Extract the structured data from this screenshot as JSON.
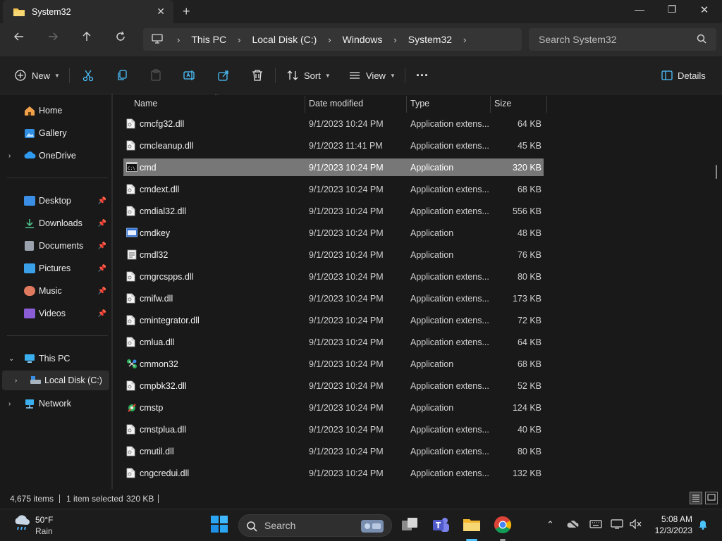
{
  "window": {
    "tab_title": "System32",
    "tab_close": "✕",
    "new_tab": "+",
    "minimize": "—",
    "maximize": "❐",
    "close": "✕"
  },
  "address": {
    "breadcrumbs": [
      "This PC",
      "Local Disk (C:)",
      "Windows",
      "System32"
    ],
    "search_placeholder": "Search System32"
  },
  "commandbar": {
    "new_label": "New",
    "sort_label": "Sort",
    "view_label": "View",
    "more_label": "···",
    "details_label": "Details"
  },
  "sidebar": {
    "home": "Home",
    "gallery": "Gallery",
    "onedrive": "OneDrive",
    "quick": [
      {
        "label": "Desktop",
        "icon": "desktop-icon",
        "color": "#3a8ee6"
      },
      {
        "label": "Downloads",
        "icon": "download-icon",
        "color": "#4cc38a"
      },
      {
        "label": "Documents",
        "icon": "document-icon",
        "color": "#9aa3ad"
      },
      {
        "label": "Pictures",
        "icon": "pictures-icon",
        "color": "#3aa0e8"
      },
      {
        "label": "Music",
        "icon": "music-icon",
        "color": "#e07a5f"
      },
      {
        "label": "Videos",
        "icon": "video-icon",
        "color": "#8a5cd6"
      }
    ],
    "this_pc": "This PC",
    "local_disk": "Local Disk (C:)",
    "network": "Network"
  },
  "list": {
    "columns": [
      "Name",
      "Date modified",
      "Type",
      "Size"
    ],
    "rows": [
      {
        "name": "cmcfg32.dll",
        "date": "9/1/2023 10:24 PM",
        "type": "Application extens...",
        "size": "64 KB",
        "icon": "dll"
      },
      {
        "name": "cmcleanup.dll",
        "date": "9/1/2023 11:41 PM",
        "type": "Application extens...",
        "size": "45 KB",
        "icon": "dll"
      },
      {
        "name": "cmd",
        "date": "9/1/2023 10:24 PM",
        "type": "Application",
        "size": "320 KB",
        "icon": "cmd",
        "selected": true
      },
      {
        "name": "cmdext.dll",
        "date": "9/1/2023 10:24 PM",
        "type": "Application extens...",
        "size": "68 KB",
        "icon": "dll"
      },
      {
        "name": "cmdial32.dll",
        "date": "9/1/2023 10:24 PM",
        "type": "Application extens...",
        "size": "556 KB",
        "icon": "dll"
      },
      {
        "name": "cmdkey",
        "date": "9/1/2023 10:24 PM",
        "type": "Application",
        "size": "48 KB",
        "icon": "app"
      },
      {
        "name": "cmdl32",
        "date": "9/1/2023 10:24 PM",
        "type": "Application",
        "size": "76 KB",
        "icon": "app2"
      },
      {
        "name": "cmgrcspps.dll",
        "date": "9/1/2023 10:24 PM",
        "type": "Application extens...",
        "size": "80 KB",
        "icon": "dll"
      },
      {
        "name": "cmifw.dll",
        "date": "9/1/2023 10:24 PM",
        "type": "Application extens...",
        "size": "173 KB",
        "icon": "dll"
      },
      {
        "name": "cmintegrator.dll",
        "date": "9/1/2023 10:24 PM",
        "type": "Application extens...",
        "size": "72 KB",
        "icon": "dll"
      },
      {
        "name": "cmlua.dll",
        "date": "9/1/2023 10:24 PM",
        "type": "Application extens...",
        "size": "64 KB",
        "icon": "dll"
      },
      {
        "name": "cmmon32",
        "date": "9/1/2023 10:24 PM",
        "type": "Application",
        "size": "68 KB",
        "icon": "app3"
      },
      {
        "name": "cmpbk32.dll",
        "date": "9/1/2023 10:24 PM",
        "type": "Application extens...",
        "size": "52 KB",
        "icon": "dll"
      },
      {
        "name": "cmstp",
        "date": "9/1/2023 10:24 PM",
        "type": "Application",
        "size": "124 KB",
        "icon": "app4"
      },
      {
        "name": "cmstplua.dll",
        "date": "9/1/2023 10:24 PM",
        "type": "Application extens...",
        "size": "40 KB",
        "icon": "dll"
      },
      {
        "name": "cmutil.dll",
        "date": "9/1/2023 10:24 PM",
        "type": "Application extens...",
        "size": "80 KB",
        "icon": "dll"
      },
      {
        "name": "cngcredui.dll",
        "date": "9/1/2023 10:24 PM",
        "type": "Application extens...",
        "size": "132 KB",
        "icon": "dll"
      }
    ]
  },
  "status": {
    "items": "4,675 items",
    "selected": "1 item selected",
    "size": "320 KB"
  },
  "taskbar": {
    "temp": "50°F",
    "condition": "Rain",
    "search_placeholder": "Search",
    "time": "5:08 AM",
    "date": "12/3/2023"
  },
  "colors": {
    "accent": "#4cc2ff",
    "selected_row": "#777777",
    "folder": "#f2c14e"
  }
}
